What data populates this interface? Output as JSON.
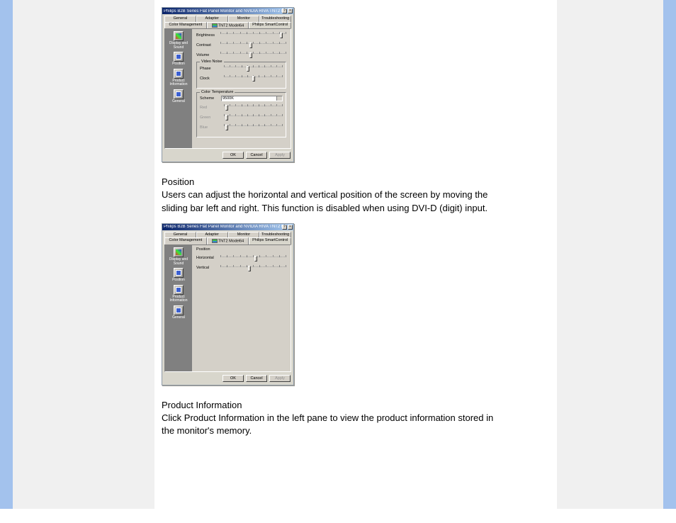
{
  "sections": {
    "position": {
      "heading": "Position",
      "body": "Users can adjust the horizontal and vertical position of the screen by moving the sliding bar left and right. This function is disabled when using DVI-D (digit) input."
    },
    "product_info": {
      "heading": "Product Information",
      "body": "Click Product Information in the left pane to view the product information stored in the monitor's memory."
    }
  },
  "dialog": {
    "title": "Philips B2B Series Flat Panel Monitor and NVIDIA RIVA TNT2 Mod...",
    "help_icon": "?",
    "close_icon": "×",
    "tabs_row1": [
      "General",
      "Adapter",
      "Monitor",
      "Troubleshooting"
    ],
    "tabs_row2": [
      "Color Management",
      "TNT2 Model64",
      "Philips SmartControl"
    ],
    "sidebar": [
      {
        "label": "Display and Sound"
      },
      {
        "label": "Position"
      },
      {
        "label": "Product Information"
      },
      {
        "label": "General"
      }
    ],
    "buttons": {
      "ok": "OK",
      "cancel": "Cancel",
      "apply": "Apply"
    }
  },
  "dialog1": {
    "sliders": {
      "brightness": "Brightness",
      "contrast": "Contrast",
      "volume": "Volume"
    },
    "video_noise": {
      "legend": "Video Noise",
      "phase": "Phase",
      "clock": "Clock"
    },
    "color_temp": {
      "legend": "Color Temperature",
      "scheme": "Scheme",
      "scheme_value": "9500K",
      "red": "Red",
      "green": "Green",
      "blue": "Blue"
    }
  },
  "dialog2": {
    "section_label": "Position",
    "horizontal": "Horizontal",
    "vertical": "Vertical"
  }
}
